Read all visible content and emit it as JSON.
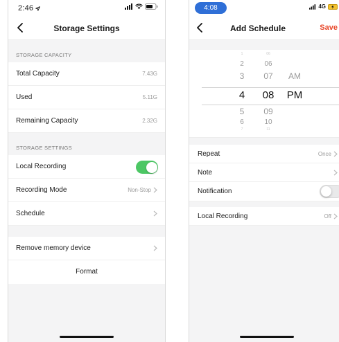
{
  "left": {
    "status_time": "2:46",
    "title": "Storage Settings",
    "capacity_header": "STORAGE CAPACITY",
    "capacity_rows": [
      {
        "label": "Total Capacity",
        "value": "7.43G"
      },
      {
        "label": "Used",
        "value": "5.11G"
      },
      {
        "label": "Remaining Capacity",
        "value": "2.32G"
      }
    ],
    "settings_header": "STORAGE SETTINGS",
    "local_recording": {
      "label": "Local Recording",
      "enabled": true
    },
    "recording_mode": {
      "label": "Recording Mode",
      "value": "Non-Stop"
    },
    "schedule": {
      "label": "Schedule"
    },
    "remove_memory": {
      "label": "Remove memory device"
    },
    "format": {
      "label": "Format"
    }
  },
  "right": {
    "status_time": "4:08",
    "network": "4G",
    "title": "Add Schedule",
    "save_label": "Save",
    "picker": {
      "hours": [
        "1",
        "2",
        "3",
        "4",
        "5",
        "6",
        "7"
      ],
      "minutes": [
        "06",
        "06",
        "07",
        "08",
        "09",
        "10",
        "11"
      ],
      "periods": [
        "AM",
        "PM"
      ],
      "selected": {
        "hour": "4",
        "minute": "08",
        "period": "PM"
      }
    },
    "repeat": {
      "label": "Repeat",
      "value": "Once"
    },
    "note": {
      "label": "Note"
    },
    "notification": {
      "label": "Notification",
      "enabled": false
    },
    "local_recording": {
      "label": "Local Recording",
      "value": "Off"
    }
  },
  "colors": {
    "toggle_on": "#4cc764",
    "accent_save": "#e8482b",
    "time_pill": "#2f6fd7"
  }
}
